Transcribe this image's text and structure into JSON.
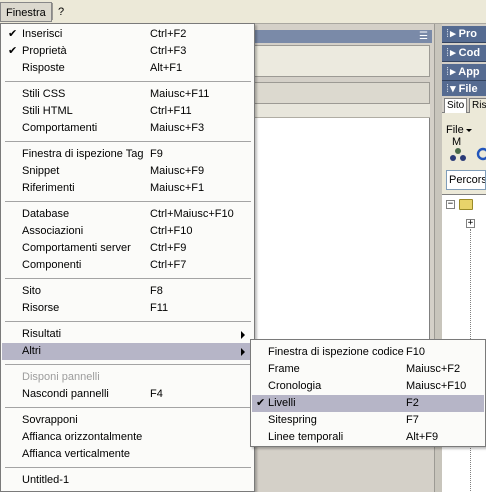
{
  "menubar": {
    "items": [
      {
        "label": "Finestra"
      },
      {
        "label": "?"
      }
    ]
  },
  "right_panels": {
    "headers": [
      "Pro",
      "Cod",
      "App",
      "File"
    ],
    "tabs": [
      "Sito",
      "Ris"
    ],
    "file_menu": "File",
    "file_menu_extra": "M",
    "path_placeholder": "Percors"
  },
  "menu": {
    "groups": [
      [
        {
          "label": "Inserisci",
          "shortcut": "Ctrl+F2",
          "checked": true
        },
        {
          "label": "Proprietà",
          "shortcut": "Ctrl+F3",
          "checked": true
        },
        {
          "label": "Risposte",
          "shortcut": "Alt+F1"
        }
      ],
      [
        {
          "label": "Stili CSS",
          "shortcut": "Maiusc+F11"
        },
        {
          "label": "Stili HTML",
          "shortcut": "Ctrl+F11"
        },
        {
          "label": "Comportamenti",
          "shortcut": "Maiusc+F3"
        }
      ],
      [
        {
          "label": "Finestra di ispezione Tag",
          "shortcut": "F9"
        },
        {
          "label": "Snippet",
          "shortcut": "Maiusc+F9"
        },
        {
          "label": "Riferimenti",
          "shortcut": "Maiusc+F1"
        }
      ],
      [
        {
          "label": "Database",
          "shortcut": "Ctrl+Maiusc+F10"
        },
        {
          "label": "Associazioni",
          "shortcut": "Ctrl+F10"
        },
        {
          "label": "Comportamenti server",
          "shortcut": "Ctrl+F9"
        },
        {
          "label": "Componenti",
          "shortcut": "Ctrl+F7"
        }
      ],
      [
        {
          "label": "Sito",
          "shortcut": "F8"
        },
        {
          "label": "Risorse",
          "shortcut": "F11"
        }
      ],
      [
        {
          "label": "Risultati",
          "submenu": true
        },
        {
          "label": "Altri",
          "submenu": true,
          "highlighted": true
        }
      ],
      [
        {
          "label": "Disponi pannelli",
          "disabled": true
        },
        {
          "label": "Nascondi pannelli",
          "shortcut": "F4"
        }
      ],
      [
        {
          "label": "Sovrapponi"
        },
        {
          "label": "Affianca orizzontalmente"
        },
        {
          "label": "Affianca verticalmente"
        }
      ],
      [
        {
          "label": "Untitled-1"
        }
      ]
    ]
  },
  "submenu": {
    "items": [
      {
        "label": "Finestra di ispezione codice",
        "shortcut": "F10"
      },
      {
        "label": "Frame",
        "shortcut": "Maiusc+F2"
      },
      {
        "label": "Cronologia",
        "shortcut": "Maiusc+F10"
      },
      {
        "label": "Livelli",
        "shortcut": "F2",
        "checked": true,
        "highlighted": true
      },
      {
        "label": "Sitespring",
        "shortcut": "F7"
      },
      {
        "label": "Linee temporali",
        "shortcut": "Alt+F9"
      }
    ]
  },
  "glyphs": {
    "check": "✔",
    "grip": "⁞",
    "collapsed": "▸",
    "expanded": "▾",
    "list_icon": "☰"
  },
  "icons": {
    "check": "check-icon",
    "submenu_arrow": "submenu-arrow-icon",
    "expand_arrow": "panel-expand-arrow-icon",
    "folder": "folder-icon"
  }
}
